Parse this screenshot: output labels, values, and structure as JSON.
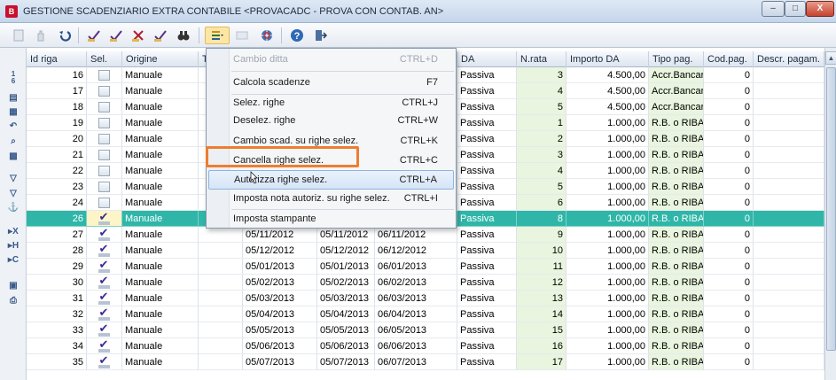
{
  "window": {
    "title": "GESTIONE SCADENZIARIO EXTRA CONTABILE <PROVACADC - PROVA CON CONTAB. AN>",
    "app_icon_text": "B",
    "btn_min": "–",
    "btn_max": "□",
    "btn_close": "X"
  },
  "grid": {
    "columns": [
      "Id riga",
      "Sel.",
      "Origine",
      "T",
      "",
      "",
      "",
      "DA",
      "N.rata",
      "Importo DA",
      "Tipo pag.",
      "Cod.pag.",
      "Descr. pagam."
    ],
    "rows": [
      {
        "id": "16",
        "sel": false,
        "origine": "Manuale",
        "d1": "",
        "d2": "",
        "d3": "",
        "da": "Passiva",
        "nrata": "3",
        "importo": "4.500,00",
        "tipo": "Accr.Bancari",
        "cod": "0"
      },
      {
        "id": "17",
        "sel": false,
        "origine": "Manuale",
        "d1": "",
        "d2": "",
        "d3": "",
        "da": "Passiva",
        "nrata": "4",
        "importo": "4.500,00",
        "tipo": "Accr.Bancari",
        "cod": "0"
      },
      {
        "id": "18",
        "sel": false,
        "origine": "Manuale",
        "d1": "",
        "d2": "",
        "d3": "",
        "da": "Passiva",
        "nrata": "5",
        "importo": "4.500,00",
        "tipo": "Accr.Bancari",
        "cod": "0"
      },
      {
        "id": "19",
        "sel": false,
        "origine": "Manuale",
        "d1": "",
        "d2": "",
        "d3": "",
        "da": "Passiva",
        "nrata": "1",
        "importo": "1.000,00",
        "tipo": "R.B. o RIBA",
        "cod": "0"
      },
      {
        "id": "20",
        "sel": false,
        "origine": "Manuale",
        "d1": "",
        "d2": "",
        "d3": "",
        "da": "Passiva",
        "nrata": "2",
        "importo": "1.000,00",
        "tipo": "R.B. o RIBA",
        "cod": "0"
      },
      {
        "id": "21",
        "sel": false,
        "origine": "Manuale",
        "d1": "",
        "d2": "",
        "d3": "",
        "da": "Passiva",
        "nrata": "3",
        "importo": "1.000,00",
        "tipo": "R.B. o RIBA",
        "cod": "0"
      },
      {
        "id": "22",
        "sel": false,
        "origine": "Manuale",
        "d1": "",
        "d2": "",
        "d3": "",
        "da": "Passiva",
        "nrata": "4",
        "importo": "1.000,00",
        "tipo": "R.B. o RIBA",
        "cod": "0"
      },
      {
        "id": "23",
        "sel": false,
        "origine": "Manuale",
        "d1": "",
        "d2": "",
        "d3": "",
        "da": "Passiva",
        "nrata": "5",
        "importo": "1.000,00",
        "tipo": "R.B. o RIBA",
        "cod": "0"
      },
      {
        "id": "24",
        "sel": false,
        "origine": "Manuale",
        "d1": "",
        "d2": "",
        "d3": "",
        "da": "Passiva",
        "nrata": "6",
        "importo": "1.000,00",
        "tipo": "R.B. o RIBA",
        "cod": "0"
      },
      {
        "id": "26",
        "sel": true,
        "origine": "Manuale",
        "d1": "",
        "d2": "",
        "d3": "",
        "da": "Passiva",
        "nrata": "8",
        "importo": "1.000,00",
        "tipo": "R.B. o RIBA",
        "cod": "0"
      },
      {
        "id": "27",
        "sel": true,
        "origine": "Manuale",
        "d1": "05/11/2012",
        "d2": "05/11/2012",
        "d3": "06/11/2012",
        "da": "Passiva",
        "nrata": "9",
        "importo": "1.000,00",
        "tipo": "R.B. o RIBA",
        "cod": "0"
      },
      {
        "id": "28",
        "sel": true,
        "origine": "Manuale",
        "d1": "05/12/2012",
        "d2": "05/12/2012",
        "d3": "06/12/2012",
        "da": "Passiva",
        "nrata": "10",
        "importo": "1.000,00",
        "tipo": "R.B. o RIBA",
        "cod": "0"
      },
      {
        "id": "29",
        "sel": true,
        "origine": "Manuale",
        "d1": "05/01/2013",
        "d2": "05/01/2013",
        "d3": "06/01/2013",
        "da": "Passiva",
        "nrata": "11",
        "importo": "1.000,00",
        "tipo": "R.B. o RIBA",
        "cod": "0"
      },
      {
        "id": "30",
        "sel": true,
        "origine": "Manuale",
        "d1": "05/02/2013",
        "d2": "05/02/2013",
        "d3": "06/02/2013",
        "da": "Passiva",
        "nrata": "12",
        "importo": "1.000,00",
        "tipo": "R.B. o RIBA",
        "cod": "0"
      },
      {
        "id": "31",
        "sel": true,
        "origine": "Manuale",
        "d1": "05/03/2013",
        "d2": "05/03/2013",
        "d3": "06/03/2013",
        "da": "Passiva",
        "nrata": "13",
        "importo": "1.000,00",
        "tipo": "R.B. o RIBA",
        "cod": "0"
      },
      {
        "id": "32",
        "sel": true,
        "origine": "Manuale",
        "d1": "05/04/2013",
        "d2": "05/04/2013",
        "d3": "06/04/2013",
        "da": "Passiva",
        "nrata": "14",
        "importo": "1.000,00",
        "tipo": "R.B. o RIBA",
        "cod": "0"
      },
      {
        "id": "33",
        "sel": true,
        "origine": "Manuale",
        "d1": "05/05/2013",
        "d2": "05/05/2013",
        "d3": "06/05/2013",
        "da": "Passiva",
        "nrata": "15",
        "importo": "1.000,00",
        "tipo": "R.B. o RIBA",
        "cod": "0"
      },
      {
        "id": "34",
        "sel": true,
        "origine": "Manuale",
        "d1": "05/06/2013",
        "d2": "05/06/2013",
        "d3": "06/06/2013",
        "da": "Passiva",
        "nrata": "16",
        "importo": "1.000,00",
        "tipo": "R.B. o RIBA",
        "cod": "0"
      },
      {
        "id": "35",
        "sel": true,
        "origine": "Manuale",
        "d1": "05/07/2013",
        "d2": "05/07/2013",
        "d3": "06/07/2013",
        "da": "Passiva",
        "nrata": "17",
        "importo": "1.000,00",
        "tipo": "R.B. o RIBA",
        "cod": "0"
      }
    ],
    "selected_row_id": "26"
  },
  "menu": {
    "items": [
      {
        "label": "Cambio ditta",
        "shortcut": "CTRL+D",
        "disabled": true
      },
      {
        "label": "Calcola scadenze",
        "shortcut": "F7",
        "disabled": false
      },
      {
        "label": "Selez. righe",
        "shortcut": "CTRL+J",
        "disabled": false
      },
      {
        "label": "Deselez. righe",
        "shortcut": "CTRL+W",
        "disabled": false
      },
      {
        "label": "Cambio scad. su righe selez.",
        "shortcut": "CTRL+K",
        "disabled": false
      },
      {
        "label": "Cancella righe selez.",
        "shortcut": "CTRL+C",
        "disabled": false
      },
      {
        "label": "Autorizza righe selez.",
        "shortcut": "CTRL+A",
        "disabled": false
      },
      {
        "label": "Imposta nota autoriz. su righe selez.",
        "shortcut": "CTRL+I",
        "disabled": false
      },
      {
        "label": "Imposta stampante",
        "shortcut": "",
        "disabled": false
      }
    ]
  },
  "sidebar": {
    "icons": [
      "1\n6",
      "▤",
      "▦",
      "↶",
      "🔍",
      "▩",
      "⛉",
      "⛉",
      "⚓",
      "▸X",
      "▸H",
      "▸C",
      "▦",
      "⎙"
    ]
  },
  "colors": {
    "selected_row": "#2fb6a8",
    "highlight_box": "#ee7d31",
    "green_column": "#e9f5de"
  }
}
